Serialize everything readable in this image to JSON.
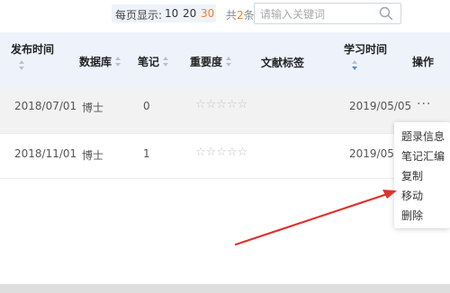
{
  "pager": {
    "per_page_label": "每页显示:",
    "options": [
      "10",
      "20",
      "30"
    ],
    "selected": "30",
    "total_prefix": "共",
    "total_count": "2",
    "total_suffix": "条"
  },
  "search": {
    "placeholder": "请输入关键词"
  },
  "table": {
    "columns": [
      "发布时间",
      "数据库",
      "笔记",
      "重要度",
      "文献标签",
      "学习时间",
      "操作"
    ],
    "rows": [
      {
        "publish_date": "2018/07/01",
        "database": "博士",
        "notes": "0",
        "importance": "☆☆☆☆☆",
        "tag": "",
        "study_time": "2019/05/05",
        "action": "···"
      },
      {
        "publish_date": "2018/11/01",
        "database": "博士",
        "notes": "1",
        "importance": "☆☆☆☆☆",
        "tag": "",
        "study_time": "2019/05/05"
      }
    ]
  },
  "action_menu": {
    "items": [
      "题录信息",
      "笔记汇编",
      "复制",
      "移动",
      "删除"
    ]
  },
  "colors": {
    "accent_orange": "#f07f2a",
    "annotation_arrow": "#e0322b",
    "header_bg": "#eef3fb"
  }
}
